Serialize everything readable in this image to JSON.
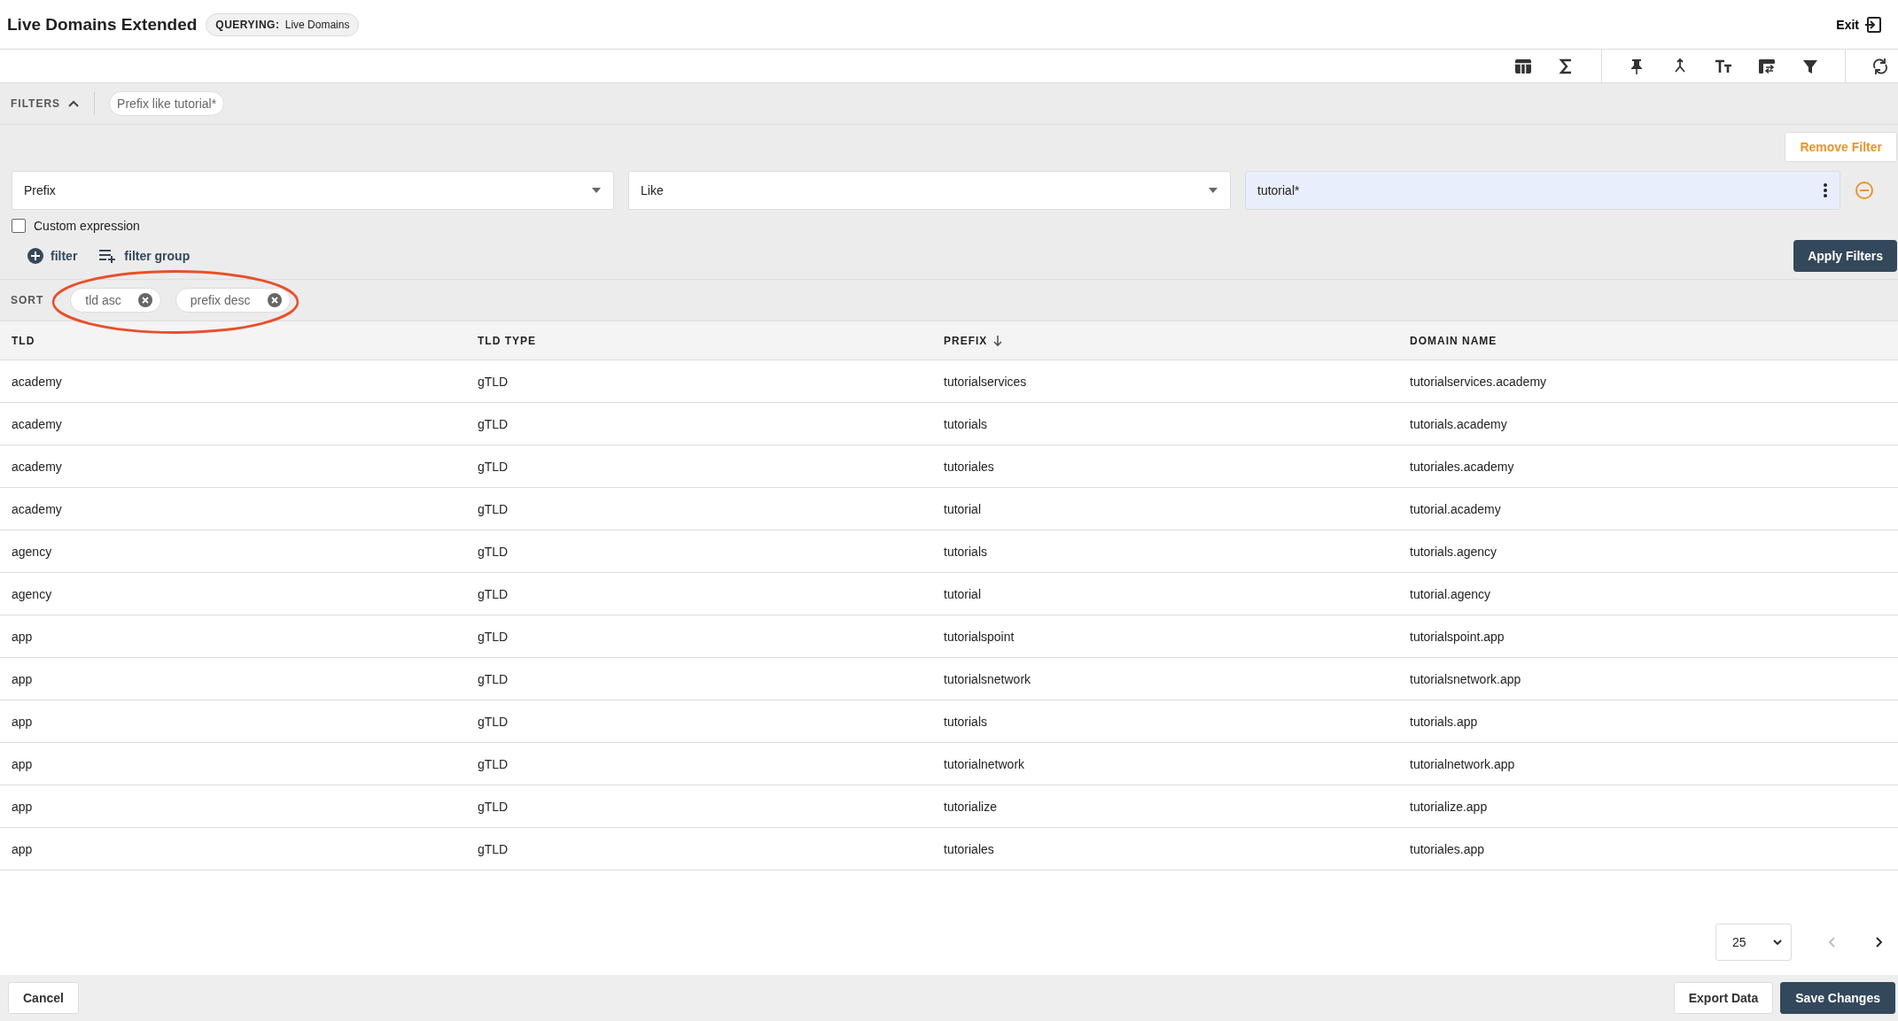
{
  "header": {
    "title": "Live Domains Extended",
    "querying_label": "QUERYING:",
    "querying_value": "Live Domains",
    "exit": "Exit"
  },
  "filters": {
    "label": "FILTERS",
    "expanded": true,
    "chip": "Prefix like tutorial*",
    "remove_button": "Remove Filter",
    "field": "Prefix",
    "operator": "Like",
    "value": "tutorial*",
    "custom_expression": {
      "label": "Custom expression",
      "checked": false
    },
    "add_filter": "filter",
    "add_group": "filter group",
    "apply_button": "Apply Filters"
  },
  "sort": {
    "label": "SORT",
    "chips": [
      "tld asc",
      "prefix desc"
    ]
  },
  "table": {
    "columns": [
      {
        "label": "TLD",
        "sorted": false
      },
      {
        "label": "TLD TYPE",
        "sorted": false
      },
      {
        "label": "PREFIX",
        "sorted": true
      },
      {
        "label": "DOMAIN NAME",
        "sorted": false
      }
    ],
    "rows": [
      [
        "academy",
        "gTLD",
        "tutorialservices",
        "tutorialservices.academy"
      ],
      [
        "academy",
        "gTLD",
        "tutorials",
        "tutorials.academy"
      ],
      [
        "academy",
        "gTLD",
        "tutoriales",
        "tutoriales.academy"
      ],
      [
        "academy",
        "gTLD",
        "tutorial",
        "tutorial.academy"
      ],
      [
        "agency",
        "gTLD",
        "tutorials",
        "tutorials.agency"
      ],
      [
        "agency",
        "gTLD",
        "tutorial",
        "tutorial.agency"
      ],
      [
        "app",
        "gTLD",
        "tutorialspoint",
        "tutorialspoint.app"
      ],
      [
        "app",
        "gTLD",
        "tutorialsnetwork",
        "tutorialsnetwork.app"
      ],
      [
        "app",
        "gTLD",
        "tutorials",
        "tutorials.app"
      ],
      [
        "app",
        "gTLD",
        "tutorialnetwork",
        "tutorialnetwork.app"
      ],
      [
        "app",
        "gTLD",
        "tutorialize",
        "tutorialize.app"
      ],
      [
        "app",
        "gTLD",
        "tutoriales",
        "tutoriales.app"
      ]
    ]
  },
  "pagination": {
    "page_size": "25",
    "prev_disabled": true,
    "next_disabled": false
  },
  "footer": {
    "cancel": "Cancel",
    "export": "Export Data",
    "save": "Save Changes"
  }
}
